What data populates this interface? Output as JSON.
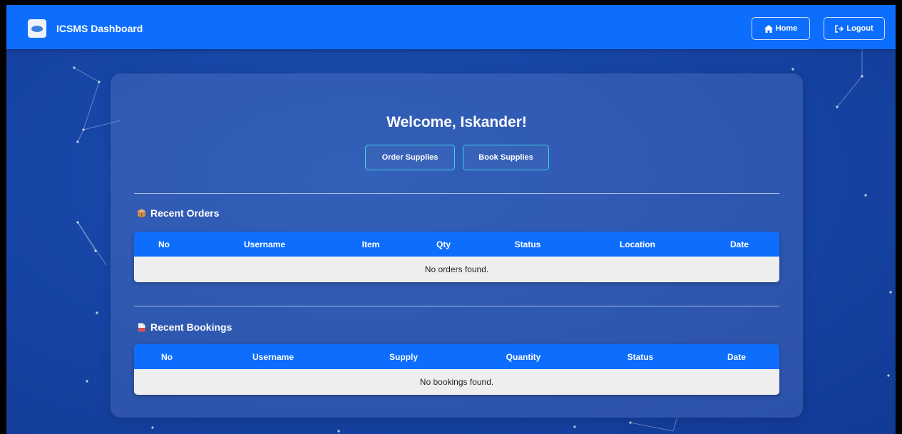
{
  "navbar": {
    "brand_title": "ICSMS Dashboard",
    "home_label": "Home",
    "logout_label": "Logout"
  },
  "welcome": "Welcome, Iskander!",
  "actions": {
    "order_label": "Order Supplies",
    "book_label": "Book Supplies"
  },
  "orders": {
    "title": "Recent Orders",
    "columns": [
      "No",
      "Username",
      "Item",
      "Qty",
      "Status",
      "Location",
      "Date"
    ],
    "empty_text": "No orders found."
  },
  "bookings": {
    "title": "Recent Bookings",
    "columns": [
      "No",
      "Username",
      "Supply",
      "Quantity",
      "Status",
      "Date"
    ],
    "empty_text": "No bookings found."
  },
  "colors": {
    "navbar": "#0d6efd",
    "background": "#1745a6",
    "button_border": "#3ad3e6",
    "table_body": "#eeeeee"
  }
}
